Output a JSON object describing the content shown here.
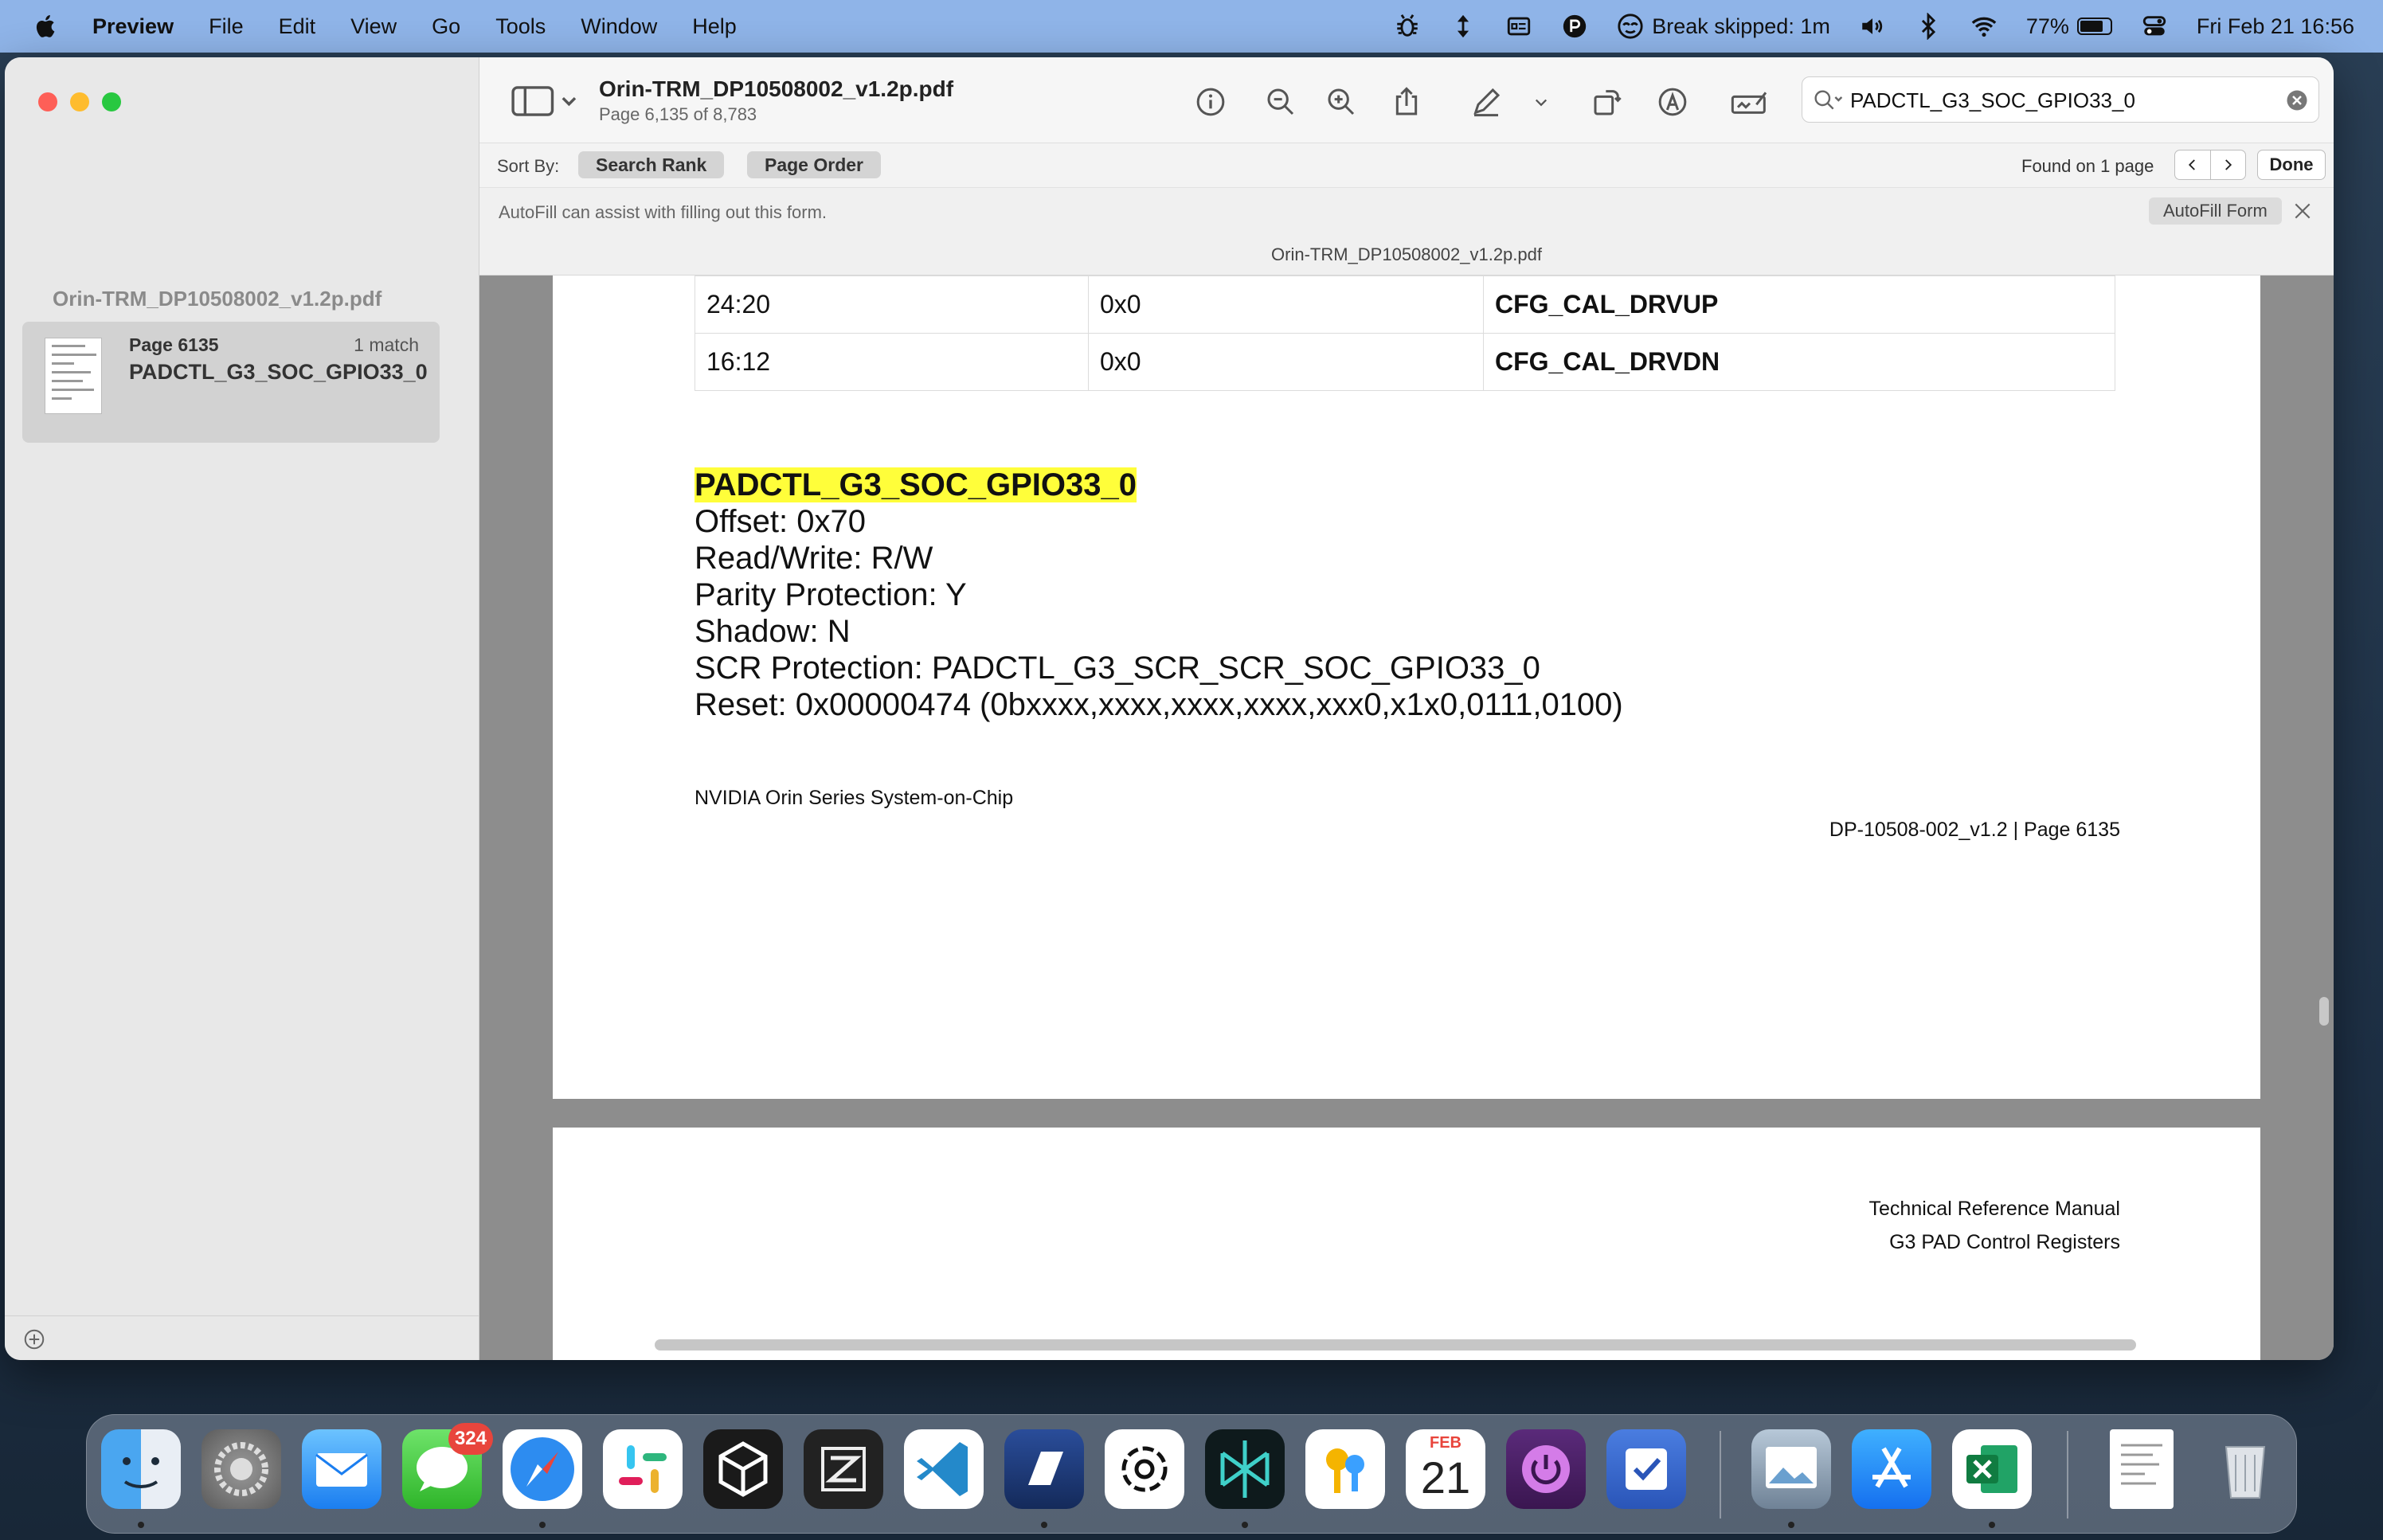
{
  "menubar": {
    "app_name": "Preview",
    "menus": [
      "File",
      "Edit",
      "View",
      "Go",
      "Tools",
      "Window",
      "Help"
    ],
    "break_status": "Break skipped: 1m",
    "battery_percent": "77%",
    "battery_level": 0.77,
    "datetime": "Fri Feb 21  16:56"
  },
  "sidebar": {
    "document_name": "Orin-TRM_DP10508002_v1.2p.pdf",
    "result": {
      "page_label": "Page 6135",
      "match_count": "1 match",
      "match_text": "PADCTL_G3_SOC_GPIO33_0"
    }
  },
  "toolbar": {
    "title": "Orin-TRM_DP10508002_v1.2p.pdf",
    "subtitle": "Page 6,135 of 8,783",
    "search_value": "PADCTL_G3_SOC_GPIO33_0"
  },
  "findbar": {
    "sort_label": "Sort By:",
    "sort_rank": "Search Rank",
    "sort_order": "Page Order",
    "found_text": "Found on 1 page",
    "done_label": "Done"
  },
  "autofill": {
    "message": "AutoFill can assist with filling out this form.",
    "button_label": "AutoFill Form"
  },
  "filebar": {
    "filename": "Orin-TRM_DP10508002_v1.2p.pdf"
  },
  "document": {
    "table_rows": [
      {
        "bits": "24:20",
        "reset": "0x0",
        "field": "CFG_CAL_DRVUP"
      },
      {
        "bits": "16:12",
        "reset": "0x0",
        "field": "CFG_CAL_DRVDN"
      }
    ],
    "register_name": "PADCTL_G3_SOC_GPIO33_0",
    "register_lines": [
      "Offset: 0x70",
      "Read/Write: R/W",
      "Parity Protection: Y",
      "Shadow: N",
      "SCR Protection: PADCTL_G3_SCR_SCR_SOC_GPIO33_0",
      "Reset: 0x00000474 (0bxxxx,xxxx,xxxx,xxxx,xxx0,x1x0,0111,0100)"
    ],
    "footer_left": "NVIDIA Orin Series System-on-Chip",
    "footer_right": "DP-10508-002_v1.2 | Page 6135",
    "next_header_1": "Technical Reference Manual",
    "next_header_2": "G3 PAD Control Registers"
  },
  "dock": {
    "messages_badge": "324",
    "calendar_month": "FEB",
    "calendar_day": "21",
    "apps": [
      "finder",
      "system-settings",
      "mail",
      "messages",
      "safari",
      "slack",
      "unity",
      "zed",
      "vscode",
      "linear",
      "chatgpt",
      "perplexity",
      "passwords",
      "power",
      "tasks",
      "preview",
      "app-store",
      "excel",
      "document",
      "trash"
    ]
  },
  "colors": {
    "menubar_bg": "#8fb4e8",
    "highlight": "#fffe3a"
  }
}
